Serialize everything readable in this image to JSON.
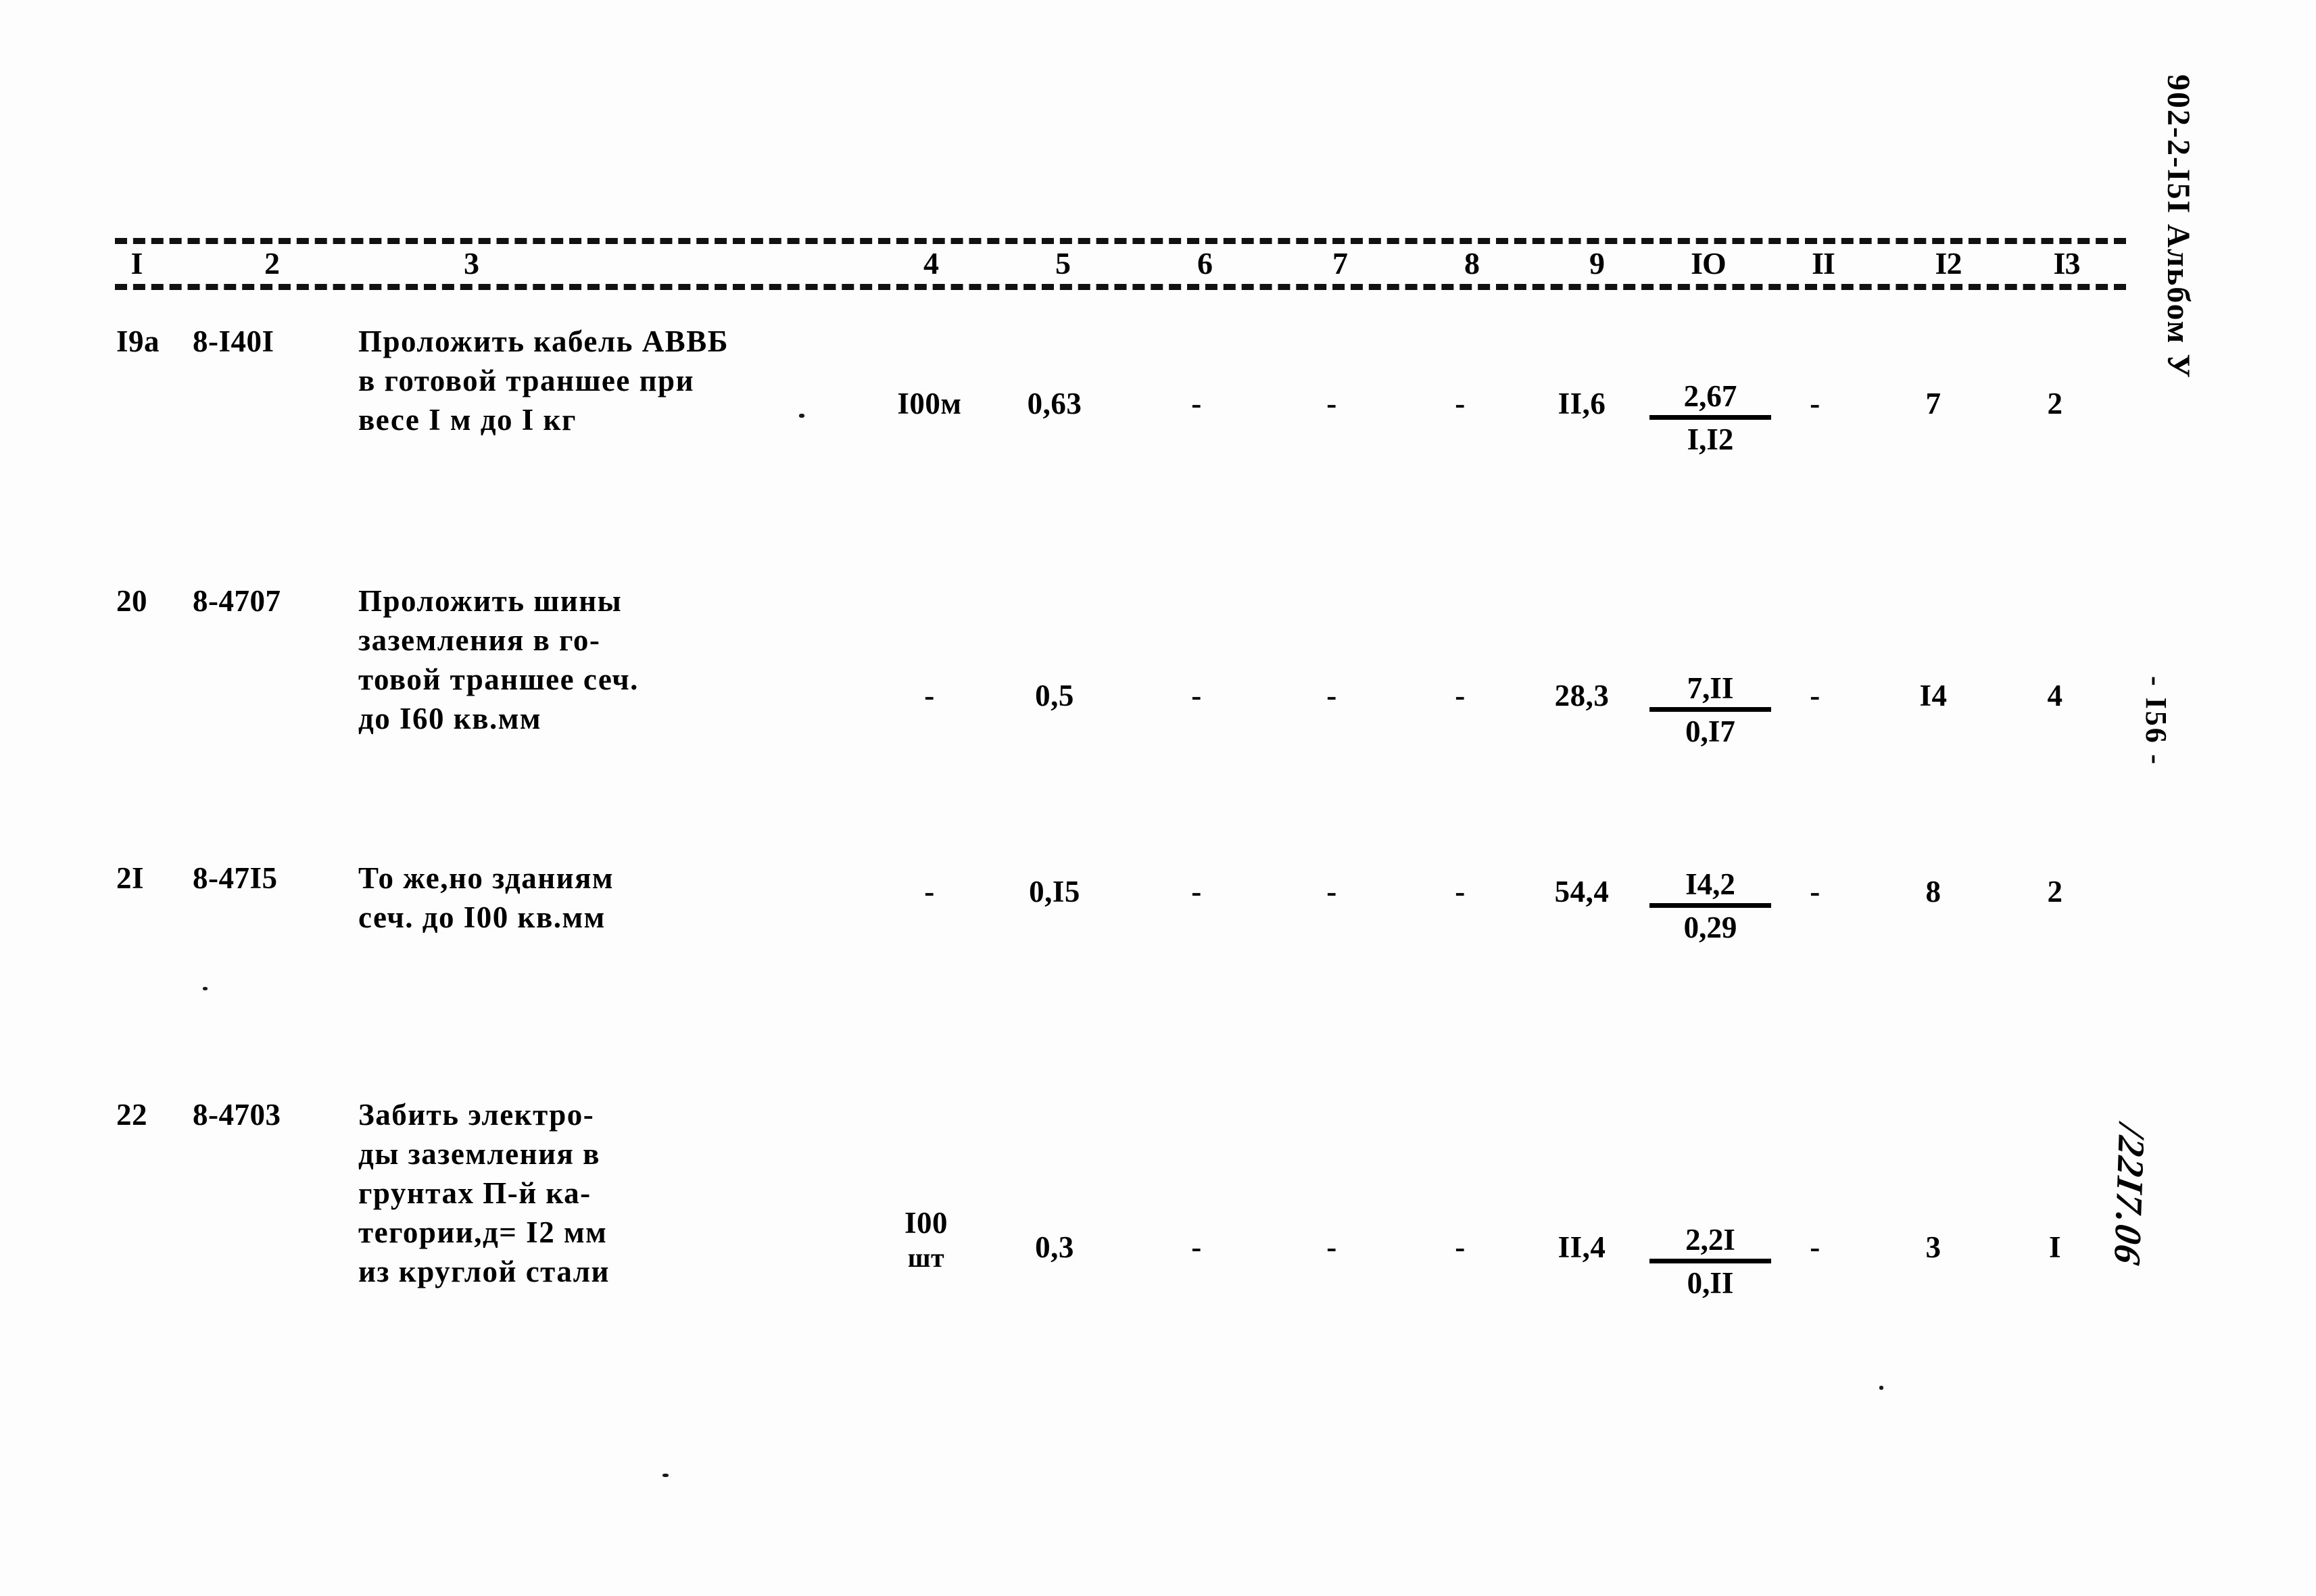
{
  "document": {
    "album_code": "902-2-I5I Альбом У",
    "page_number": "- I56 -",
    "handwritten_note": "/22I7.06"
  },
  "table": {
    "column_headers": [
      "I",
      "2",
      "3",
      "4",
      "5",
      "6",
      "7",
      "8",
      "9",
      "IO",
      "II",
      "I2",
      "I3"
    ],
    "rows": [
      {
        "c1": "I9а",
        "c2": "8-I40I",
        "c3_lines": [
          "Проложить кабель АВВБ",
          "в готовой траншее при",
          "весе I м до I кг"
        ],
        "c4": "I00м",
        "c5": "0,63",
        "c6": "-",
        "c7": "-",
        "c8": "-",
        "c9": "II,6",
        "c10_top": "2,67",
        "c10_bottom": "I,I2",
        "c11": "-",
        "c12": "7",
        "c13": "2"
      },
      {
        "c1": "20",
        "c2": "8-4707",
        "c3_lines": [
          "Проложить шины",
          "заземления в го-",
          "товой траншее сеч.",
          "до I60 кв.мм"
        ],
        "c4": "-",
        "c5": "0,5",
        "c6": "-",
        "c7": "-",
        "c8": "-",
        "c9": "28,3",
        "c10_top": "7,II",
        "c10_bottom": "0,I7",
        "c11": "-",
        "c12": "I4",
        "c13": "4"
      },
      {
        "c1": "2I",
        "c2": "8-47I5",
        "c3_lines": [
          "То же,но зданиям",
          "сеч. до I00 кв.мм"
        ],
        "c4": "-",
        "c5": "0,I5",
        "c6": "-",
        "c7": "-",
        "c8": "-",
        "c9": "54,4",
        "c10_top": "I4,2",
        "c10_bottom": "0,29",
        "c11": "-",
        "c12": "8",
        "c13": "2"
      },
      {
        "c1": "22",
        "c2": "8-4703",
        "c3_lines": [
          "Забить электро-",
          "ды заземления в",
          "грунтах П-й ка-",
          "тегории,д= I2 мм",
          "из круглой стали"
        ],
        "c4_line1": "I00",
        "c4_line2": "шт",
        "c5": "0,3",
        "c6": "-",
        "c7": "-",
        "c8": "-",
        "c9": "II,4",
        "c10_top": "2,2I",
        "c10_bottom": "0,II",
        "c11": "-",
        "c12": "3",
        "c13": "I"
      }
    ]
  }
}
